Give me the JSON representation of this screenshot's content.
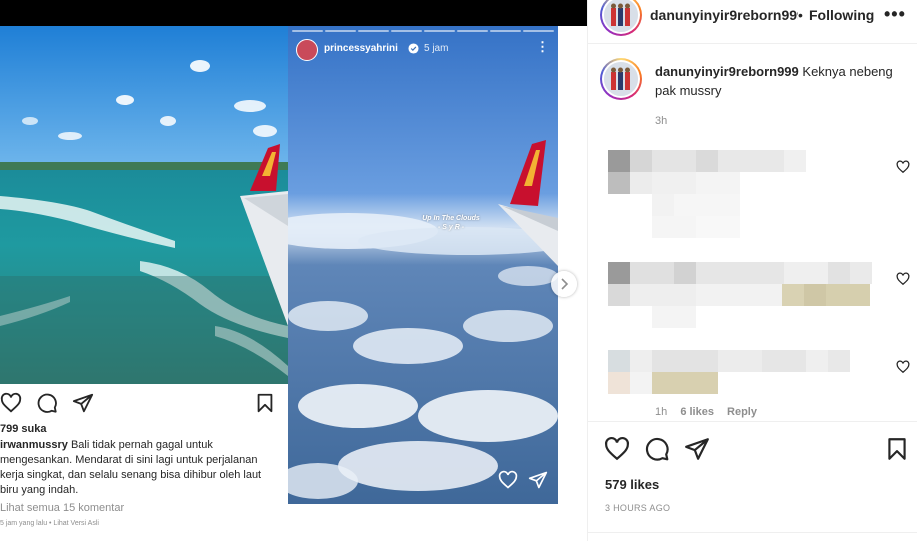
{
  "embed_post": {
    "likes": "799 suka",
    "caption_user": "irwanmussry",
    "caption_text": "Bali tidak pernah gagal untuk mengesankan. Mendarat di sini lagi untuk perjalanan kerja singkat, dan selalu senang bisa dihibur oleh laut biru yang indah.",
    "view_comments": "Lihat semua 15 komentar",
    "meta": "5 jam yang lalu • Lihat Versi Asli"
  },
  "embed_story": {
    "username": "princessyahrini",
    "time": "5 jam",
    "sticker_line1": "Up In The Clouds",
    "sticker_line2": "- S y R -"
  },
  "header": {
    "username": "danunyinyir9reborn999",
    "separator": "•",
    "follow_status": "Following",
    "more": "•••"
  },
  "caption": {
    "username": "danunyinyir9reborn999",
    "text": "Keknya nebeng pak mussry",
    "time": "3h"
  },
  "comment_meta": {
    "time": "1h",
    "likes": "6 likes",
    "reply": "Reply"
  },
  "post": {
    "likes": "579 likes",
    "time": "3 HOURS AGO"
  },
  "colors": {
    "text": "#262626",
    "secondary": "#8e8e8e",
    "divider": "#efefef"
  },
  "icons": [
    "heart-icon",
    "comment-icon",
    "share-icon",
    "bookmark-icon",
    "more-icon",
    "verified-icon",
    "chevron-right-icon"
  ]
}
